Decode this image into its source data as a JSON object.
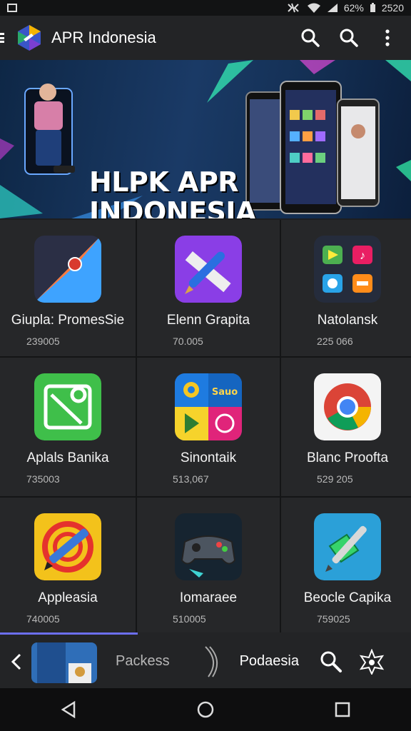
{
  "status_bar": {
    "battery": "62%",
    "time": "2520"
  },
  "app_bar": {
    "title": "APR Indonesia",
    "actions": [
      "search-icon",
      "search-icon",
      "more-vertical-icon"
    ]
  },
  "banner": {
    "line1": "HLPK APR",
    "line2": "INDONESIA"
  },
  "apps": [
    {
      "name": "Giupla: PromesSie",
      "count": "239005",
      "icon": "compass-icon"
    },
    {
      "name": "Elenn Grapita",
      "count": "70.005",
      "icon": "pen-ruler-icon"
    },
    {
      "name": "Natolansk",
      "count": "225 066",
      "icon": "app-folder-icon"
    },
    {
      "name": "Aplals Banika",
      "count": "735003",
      "icon": "photo-edit-icon"
    },
    {
      "name": "Sinontaik",
      "count": "513,067",
      "icon": "play-store-icon"
    },
    {
      "name": "Blanc Proofta",
      "count": "529 205",
      "icon": "chrome-icon"
    },
    {
      "name": "Appleasia",
      "count": "740005",
      "icon": "pencil-target-icon"
    },
    {
      "name": "Iomaraee",
      "count": "510005",
      "icon": "gamepad-icon"
    },
    {
      "name": "Beocle Capika",
      "count": "759025",
      "icon": "stylus-cube-icon"
    }
  ],
  "tabs": {
    "left": "Packess",
    "right": "Podaesia"
  },
  "colors": {
    "accent": "#6c6ff0",
    "background": "#1d1e20"
  }
}
